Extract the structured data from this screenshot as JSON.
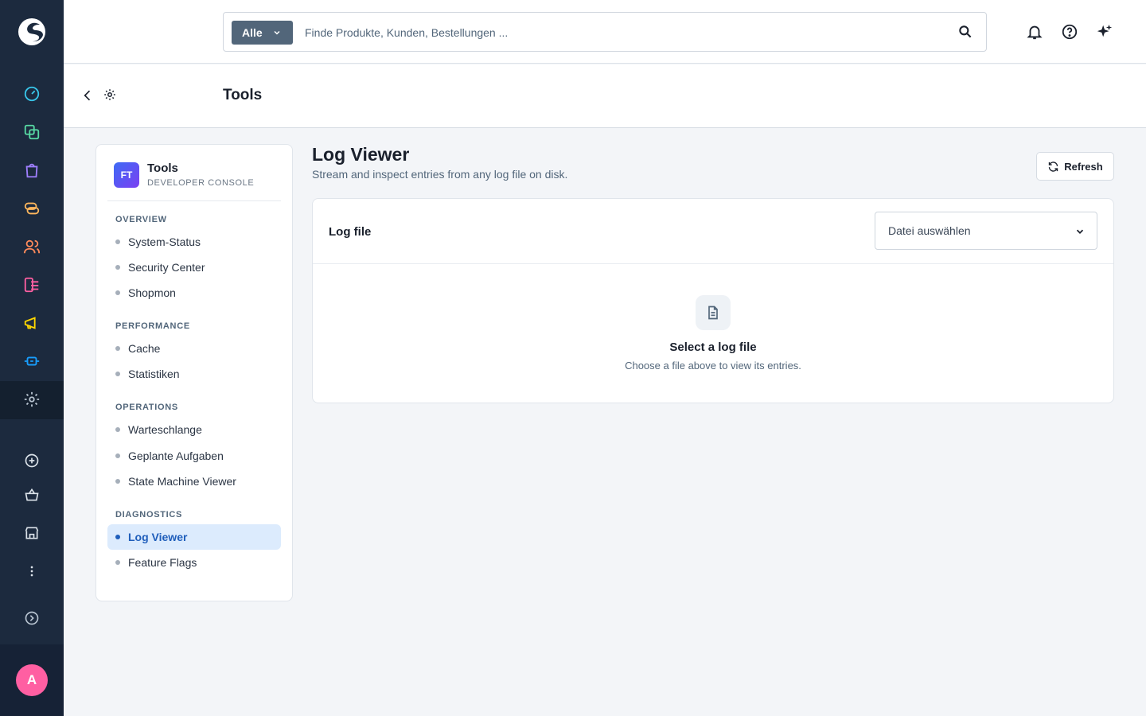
{
  "rail": {
    "avatar_initial": "A",
    "icons": [
      "dashboard-icon",
      "orders-icon",
      "catalog-icon",
      "customers-rings-icon",
      "customers-icon",
      "content-icon",
      "marketing-icon",
      "extensions-icon",
      "settings-icon",
      "add-icon",
      "basket-icon",
      "store-icon",
      "more-icon",
      "expand-icon"
    ],
    "colors": {
      "bg": "#1c2a3e",
      "accent_cyan": "#38c6ea",
      "accent_green": "#57d9a3",
      "accent_purple": "#9f7fff",
      "accent_orange": "#ffb75d",
      "accent_peach": "#ff8a5b",
      "accent_pink": "#ff5fa2",
      "accent_yellow": "#ffd700",
      "accent_blue": "#189eff"
    }
  },
  "search": {
    "scope_label": "Alle",
    "placeholder": "Finde Produkte, Kunden, Bestellungen ..."
  },
  "topbar": {
    "icons": [
      "bell-icon",
      "help-icon",
      "sparkle-icon"
    ]
  },
  "page": {
    "title": "Tools"
  },
  "sidebar": {
    "badge": "FT",
    "app_name": "Tools",
    "app_sub": "DEVELOPER CONSOLE",
    "groups": [
      {
        "label": "OVERVIEW",
        "items": [
          "System-Status",
          "Security Center",
          "Shopmon"
        ]
      },
      {
        "label": "PERFORMANCE",
        "items": [
          "Cache",
          "Statistiken"
        ]
      },
      {
        "label": "OPERATIONS",
        "items": [
          "Warteschlange",
          "Geplante Aufgaben",
          "State Machine Viewer"
        ]
      },
      {
        "label": "DIAGNOSTICS",
        "items": [
          "Log Viewer",
          "Feature Flags"
        ]
      }
    ],
    "active_item": "Log Viewer"
  },
  "main": {
    "title": "Log Viewer",
    "subtitle": "Stream and inspect entries from any log file on disk.",
    "refresh_label": "Refresh",
    "log_file_label": "Log file",
    "select_value": "Datei auswählen",
    "empty_title": "Select a log file",
    "empty_desc": "Choose a file above to view its entries."
  }
}
